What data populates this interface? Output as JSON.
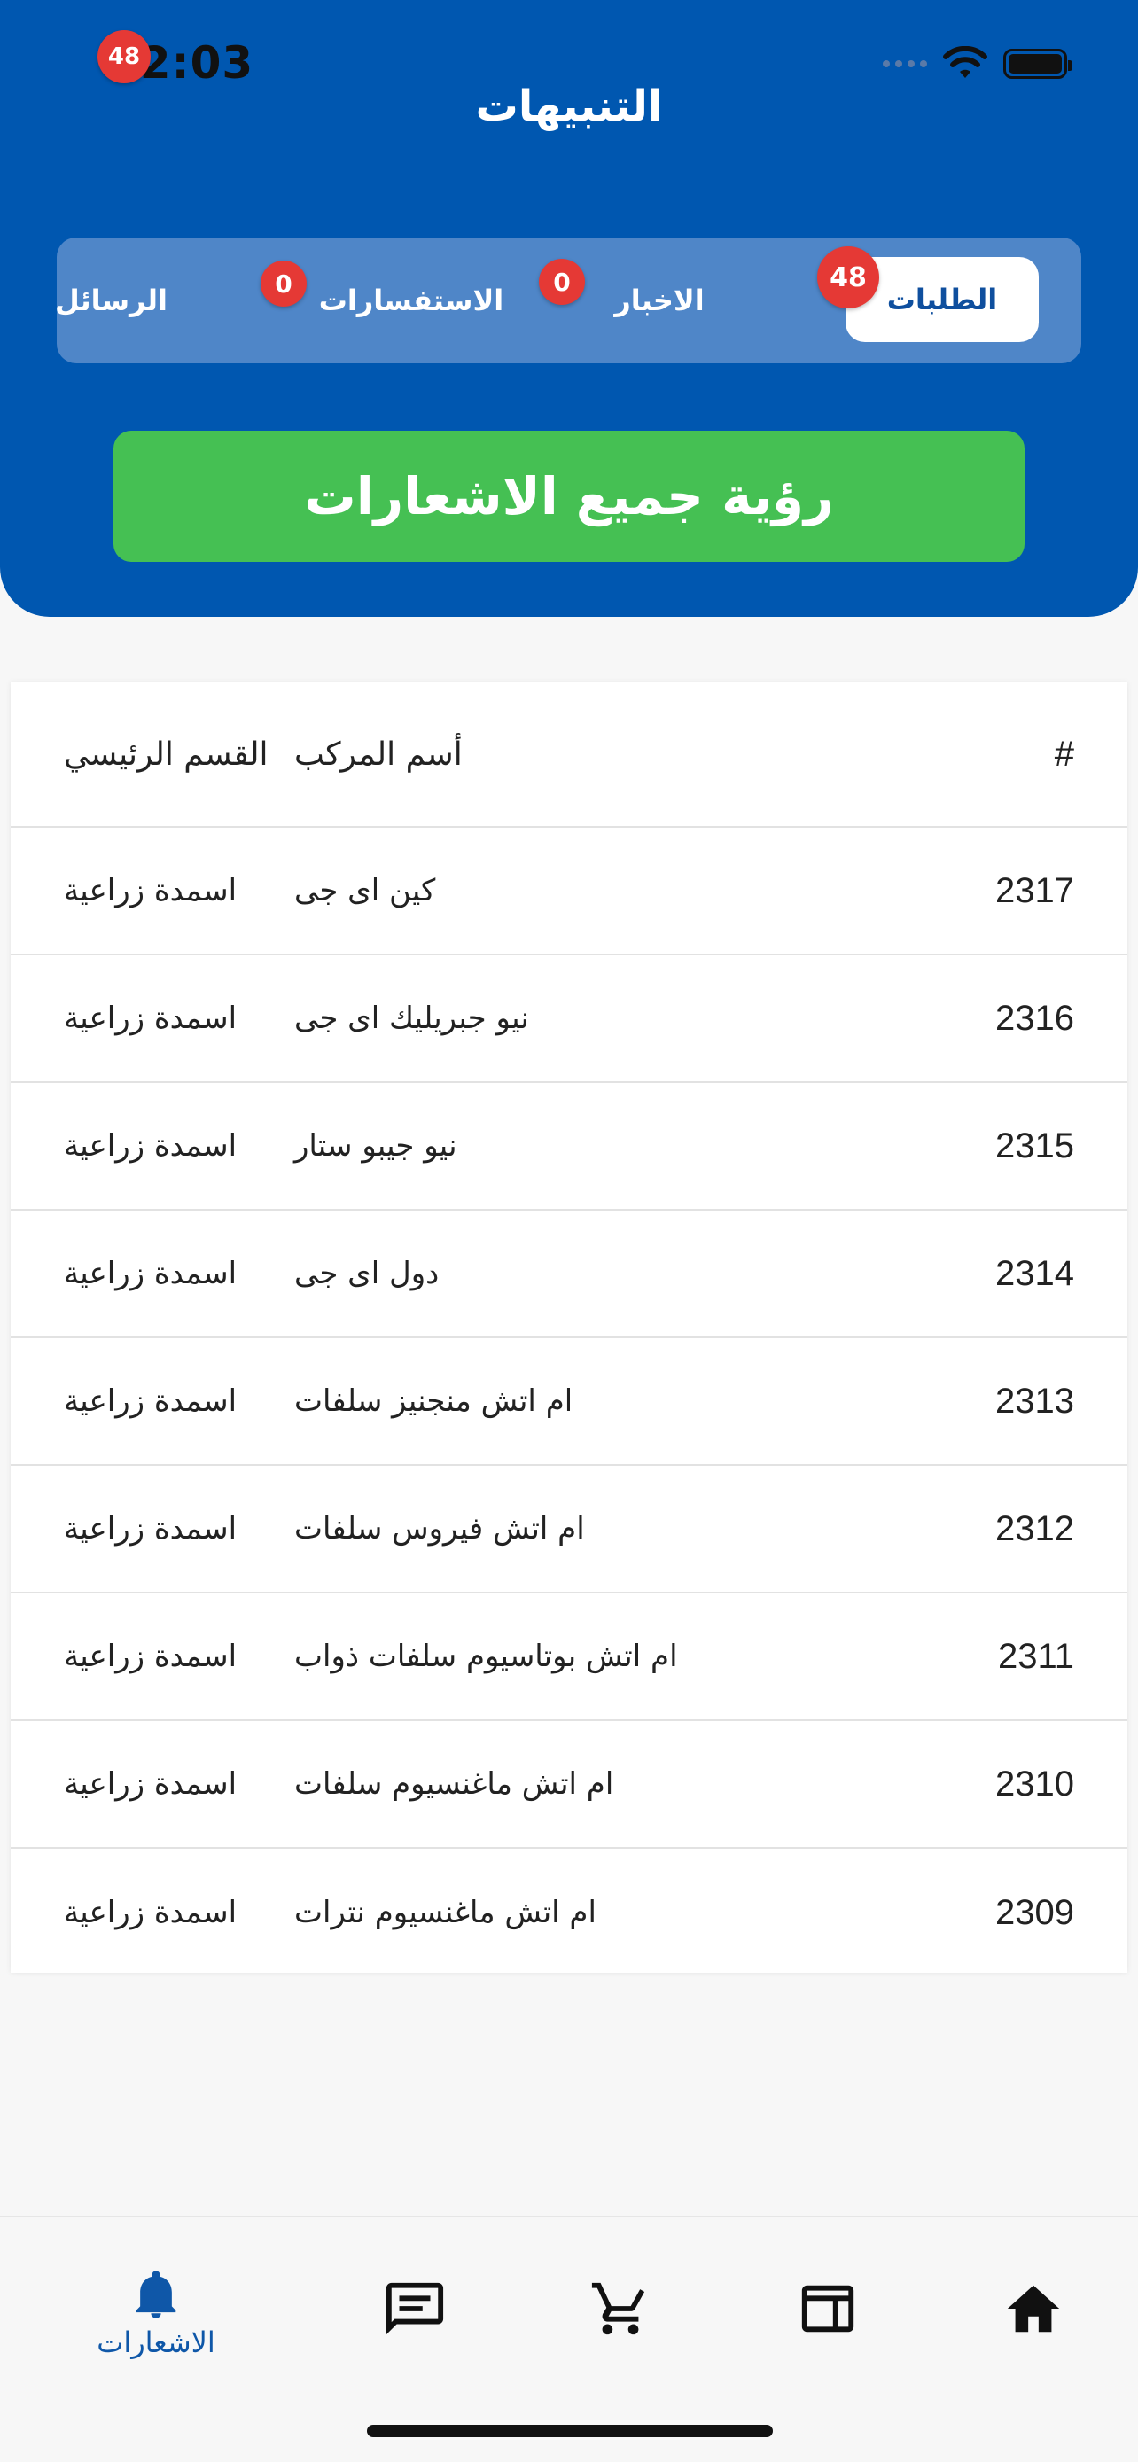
{
  "status_bar": {
    "time": "12:03"
  },
  "header": {
    "title": "التنبيهات"
  },
  "tabs": [
    {
      "label": "الطلبات",
      "badge": "48",
      "active": true
    },
    {
      "label": "الاخبار",
      "badge": "0"
    },
    {
      "label": "الاستفسارات",
      "badge": "0"
    },
    {
      "label": "الرسائل"
    }
  ],
  "cta": {
    "label": "رؤية جميع الاشعارات"
  },
  "table": {
    "headers": {
      "id": "#",
      "name": "أسم المركب",
      "category": "القسم الرئيسي"
    },
    "rows": [
      {
        "id": "2317",
        "name": "كين اى جى",
        "category": "اسمدة زراعية"
      },
      {
        "id": "2316",
        "name": "نيو جبريليك اى جى",
        "category": "اسمدة زراعية"
      },
      {
        "id": "2315",
        "name": "نيو جيبو ستار",
        "category": "اسمدة زراعية"
      },
      {
        "id": "2314",
        "name": "دول اى جى",
        "category": "اسمدة زراعية"
      },
      {
        "id": "2313",
        "name": "ام اتش منجنيز سلفات",
        "category": "اسمدة زراعية"
      },
      {
        "id": "2312",
        "name": "ام اتش فيروس سلفات",
        "category": "اسمدة زراعية"
      },
      {
        "id": "2311",
        "name": "ام اتش بوتاسيوم سلفات ذواب",
        "category": "اسمدة زراعية"
      },
      {
        "id": "2310",
        "name": "ام اتش ماغنسيوم سلفات",
        "category": "اسمدة زراعية"
      },
      {
        "id": "2309",
        "name": "ام اتش ماغنسيوم نترات",
        "category": "اسمدة زراعية"
      }
    ]
  },
  "bottom_nav": {
    "notifications_label": "الاشعارات",
    "notifications_badge": "48",
    "items": [
      {
        "icon": "bell-icon",
        "active": true
      },
      {
        "icon": "message-icon"
      },
      {
        "icon": "cart-icon"
      },
      {
        "icon": "newspaper-icon"
      },
      {
        "icon": "home-icon"
      }
    ]
  },
  "colors": {
    "header": "#0057b0",
    "tabs_bg": "#4f86c8",
    "cta": "#45c053",
    "badge": "#e53935",
    "active_nav": "#0f57a8"
  }
}
